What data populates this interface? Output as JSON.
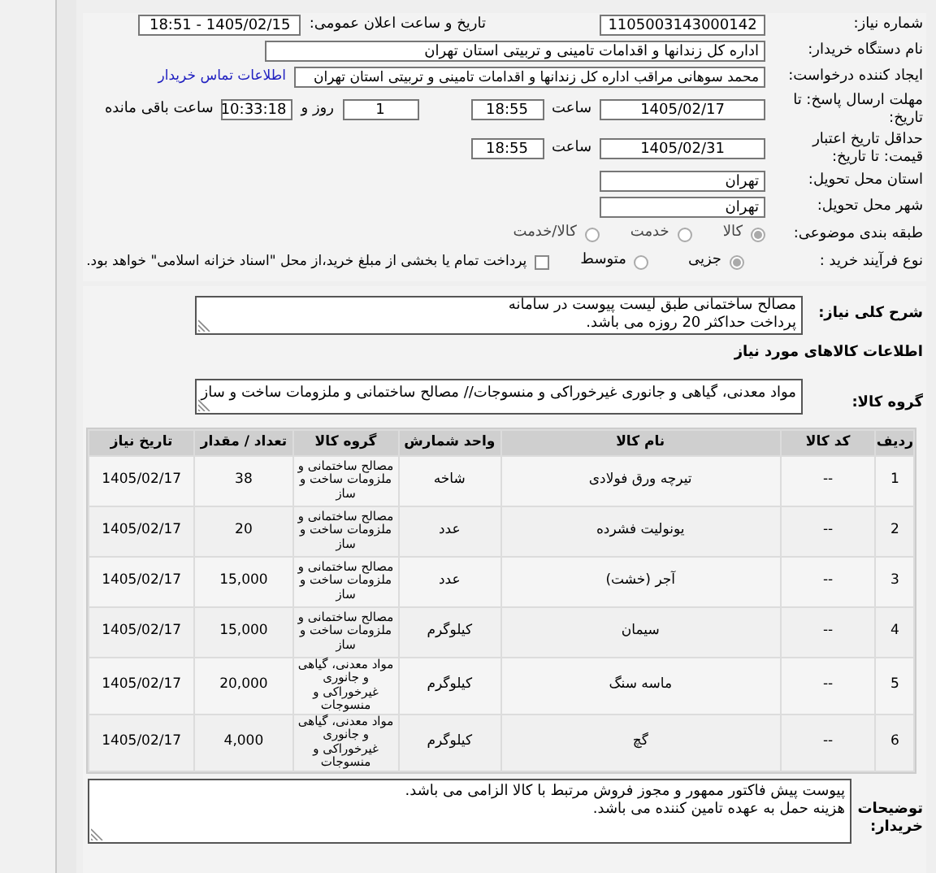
{
  "need_number": {
    "label": "شماره نیاز:",
    "value": "1105003143000142"
  },
  "announce": {
    "label": "تاریخ و ساعت اعلان عمومی:",
    "value": "1405/02/15 - 18:51"
  },
  "buyer_org": {
    "label": "نام دستگاه خریدار:",
    "value": "اداره کل زندانها و اقدامات تامینی و تربیتی استان تهران"
  },
  "requester": {
    "label": "ایجاد کننده درخواست:",
    "value": "محمد سوهانی مراقب  اداره کل زندانها و اقدامات تامینی و تربیتی استان تهران",
    "link": "اطلاعات تماس خریدار"
  },
  "deadline": {
    "label": "مهلت ارسال پاسخ: تا تاریخ:",
    "date": "1405/02/17",
    "time_label": "ساعت",
    "time": "18:55",
    "days": "1",
    "days_label": "روز و",
    "remaining": "10:33:18",
    "remaining_label": "ساعت باقی مانده"
  },
  "validity": {
    "label": "حداقل تاریخ اعتبار قیمت: تا تاریخ:",
    "date": "1405/02/31",
    "time_label": "ساعت",
    "time": "18:55"
  },
  "province": {
    "label": "استان محل تحویل:",
    "value": "تهران"
  },
  "city": {
    "label": "شهر محل تحویل:",
    "value": "تهران"
  },
  "category": {
    "label": "طبقه بندی موضوعی:",
    "options": [
      {
        "label": "کالا",
        "selected": true
      },
      {
        "label": "خدمت",
        "selected": false
      },
      {
        "label": "کالا/خدمت",
        "selected": false
      }
    ]
  },
  "process": {
    "label": "نوع فرآیند خرید :",
    "options": [
      {
        "label": "جزیی",
        "selected": true
      },
      {
        "label": "متوسط",
        "selected": false
      }
    ],
    "payment": {
      "label": "پرداخت تمام یا بخشی از مبلغ خرید،از محل \"اسناد خزانه اسلامی\" خواهد بود.",
      "checked": false
    }
  },
  "description": {
    "label": "شرح کلی نیاز:",
    "lines": [
      "مصالح ساختمانی طبق لیست پیوست در سامانه",
      "پرداخت حداکثر 20 روزه می باشد."
    ]
  },
  "goods_title": "اطلاعات کالاهای مورد نیاز",
  "goods_group": {
    "label": "گروه کالا:",
    "value": "مواد معدنی، گیاهی و جانوری غیرخوراکی و منسوجات// مصالح ساختمانی و ملزومات ساخت و ساز"
  },
  "table": {
    "columns": [
      "ردیف",
      "کد کالا",
      "نام کالا",
      "واحد شمارش",
      "گروه کالا",
      "تعداد / مقدار",
      "تاریخ نیاز"
    ],
    "rows": [
      [
        "1",
        "--",
        "تیرچه ورق فولادی",
        "شاخه",
        "مصالح ساختمانی و ملزومات ساخت و ساز",
        "38",
        "1405/02/17"
      ],
      [
        "2",
        "--",
        "یونولیت فشرده",
        "عدد",
        "مصالح ساختمانی و ملزومات ساخت و ساز",
        "20",
        "1405/02/17"
      ],
      [
        "3",
        "--",
        "آجر (خشت)",
        "عدد",
        "مصالح ساختمانی و ملزومات ساخت و ساز",
        "15,000",
        "1405/02/17"
      ],
      [
        "4",
        "--",
        "سیمان",
        "کیلوگرم",
        "مصالح ساختمانی و ملزومات ساخت و ساز",
        "15,000",
        "1405/02/17"
      ],
      [
        "5",
        "--",
        "ماسه سنگ",
        "کیلوگرم",
        "مواد معدنی، گیاهی و جانوری غیرخوراکی و منسوجات",
        "20,000",
        "1405/02/17"
      ],
      [
        "6",
        "--",
        "گچ",
        "کیلوگرم",
        "مواد معدنی، گیاهی و جانوری غیرخوراکی و منسوجات",
        "4,000",
        "1405/02/17"
      ]
    ]
  },
  "buyer_notes": {
    "label": "توضیحات خریدار:",
    "lines": [
      "پیوست پیش فاکتور ممهور و مجوز فروش مرتبط با کالا الزامی می باشد.",
      "هزینه حمل به عهده تامین کننده می باشد."
    ]
  }
}
